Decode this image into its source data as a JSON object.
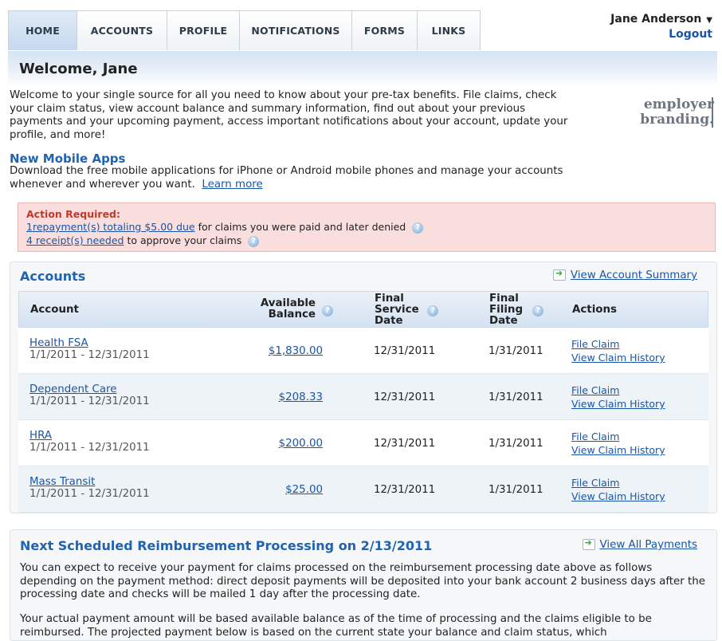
{
  "nav": {
    "tabs": [
      {
        "label": "HOME",
        "active": true
      },
      {
        "label": "ACCOUNTS",
        "active": false
      },
      {
        "label": "PROFILE",
        "active": false
      },
      {
        "label": "NOTIFICATIONS",
        "active": false
      },
      {
        "label": "FORMS",
        "active": false
      },
      {
        "label": "LINKS",
        "active": false
      }
    ],
    "user_name": "Jane Anderson",
    "logout_label": "Logout"
  },
  "welcome": {
    "title": "Welcome, Jane",
    "intro": "Welcome to your single source for all you need to know about your pre-tax benefits.  File claims, check your claim status, view account balance and summary information, find out about your previous payments and your upcoming payment, access important notifications about your account, update your profile, and more!",
    "branding_line1": "employer",
    "branding_line2": "branding"
  },
  "mobile": {
    "title": "New Mobile Apps",
    "text": "Download the free mobile applications for iPhone or Android mobile phones and manage your accounts whenever and wherever you want.",
    "link": "Learn more"
  },
  "action_required": {
    "title": "Action Required:",
    "line1_link": "1repayment(s) totaling $5.00 due",
    "line1_text": " for claims you were paid and later denied",
    "line2_link": "4 receipt(s) needed",
    "line2_text": " to approve your claims"
  },
  "accounts": {
    "title": "Accounts",
    "summary_link": "View Account Summary",
    "headers": {
      "account": "Account",
      "available_balance": "Available Balance",
      "final_service_date": "Final Service Date",
      "final_filing_date": "Final Filing Date",
      "actions": "Actions"
    },
    "rows": [
      {
        "name": "Health FSA",
        "period": "1/1/2011 - 12/31/2011",
        "balance": "$1,830.00",
        "service_date": "12/31/2011",
        "filing_date": "1/31/2011",
        "action1": "File Claim",
        "action2": "View Claim History"
      },
      {
        "name": "Dependent Care",
        "period": "1/1/2011 - 12/31/2011",
        "balance": "$208.33",
        "service_date": "12/31/2011",
        "filing_date": "1/31/2011",
        "action1": "File Claim",
        "action2": "View Claim History"
      },
      {
        "name": "HRA",
        "period": "1/1/2011 - 12/31/2011",
        "balance": "$200.00",
        "service_date": "12/31/2011",
        "filing_date": "1/31/2011",
        "action1": "File Claim",
        "action2": "View Claim History"
      },
      {
        "name": "Mass Transit",
        "period": "1/1/2011 - 12/31/2011",
        "balance": "$25.00",
        "service_date": "12/31/2011",
        "filing_date": "1/31/2011",
        "action1": "File Claim",
        "action2": "View Claim History"
      }
    ]
  },
  "next_reimbursement": {
    "title": "Next Scheduled Reimbursement Processing on 2/13/2011",
    "link": "View All Payments",
    "text1": "You can expect to receive your payment for claims processed on the reimbursement processing date above as follows depending on the payment method:  direct deposit payments will be deposited into your bank account 2 business days after the processing date and checks will be mailed 1 day after the processing date.",
    "text2": "Your actual payment amount will be based available balance as of the time of processing and the claims eligible to be reimbursed.  The projected payment below is based on the current state your balance and claim status, which"
  },
  "icons": {
    "help": "question-help-icon",
    "go": "green-arrow-icon",
    "user_menu": "caret-down-icon"
  }
}
